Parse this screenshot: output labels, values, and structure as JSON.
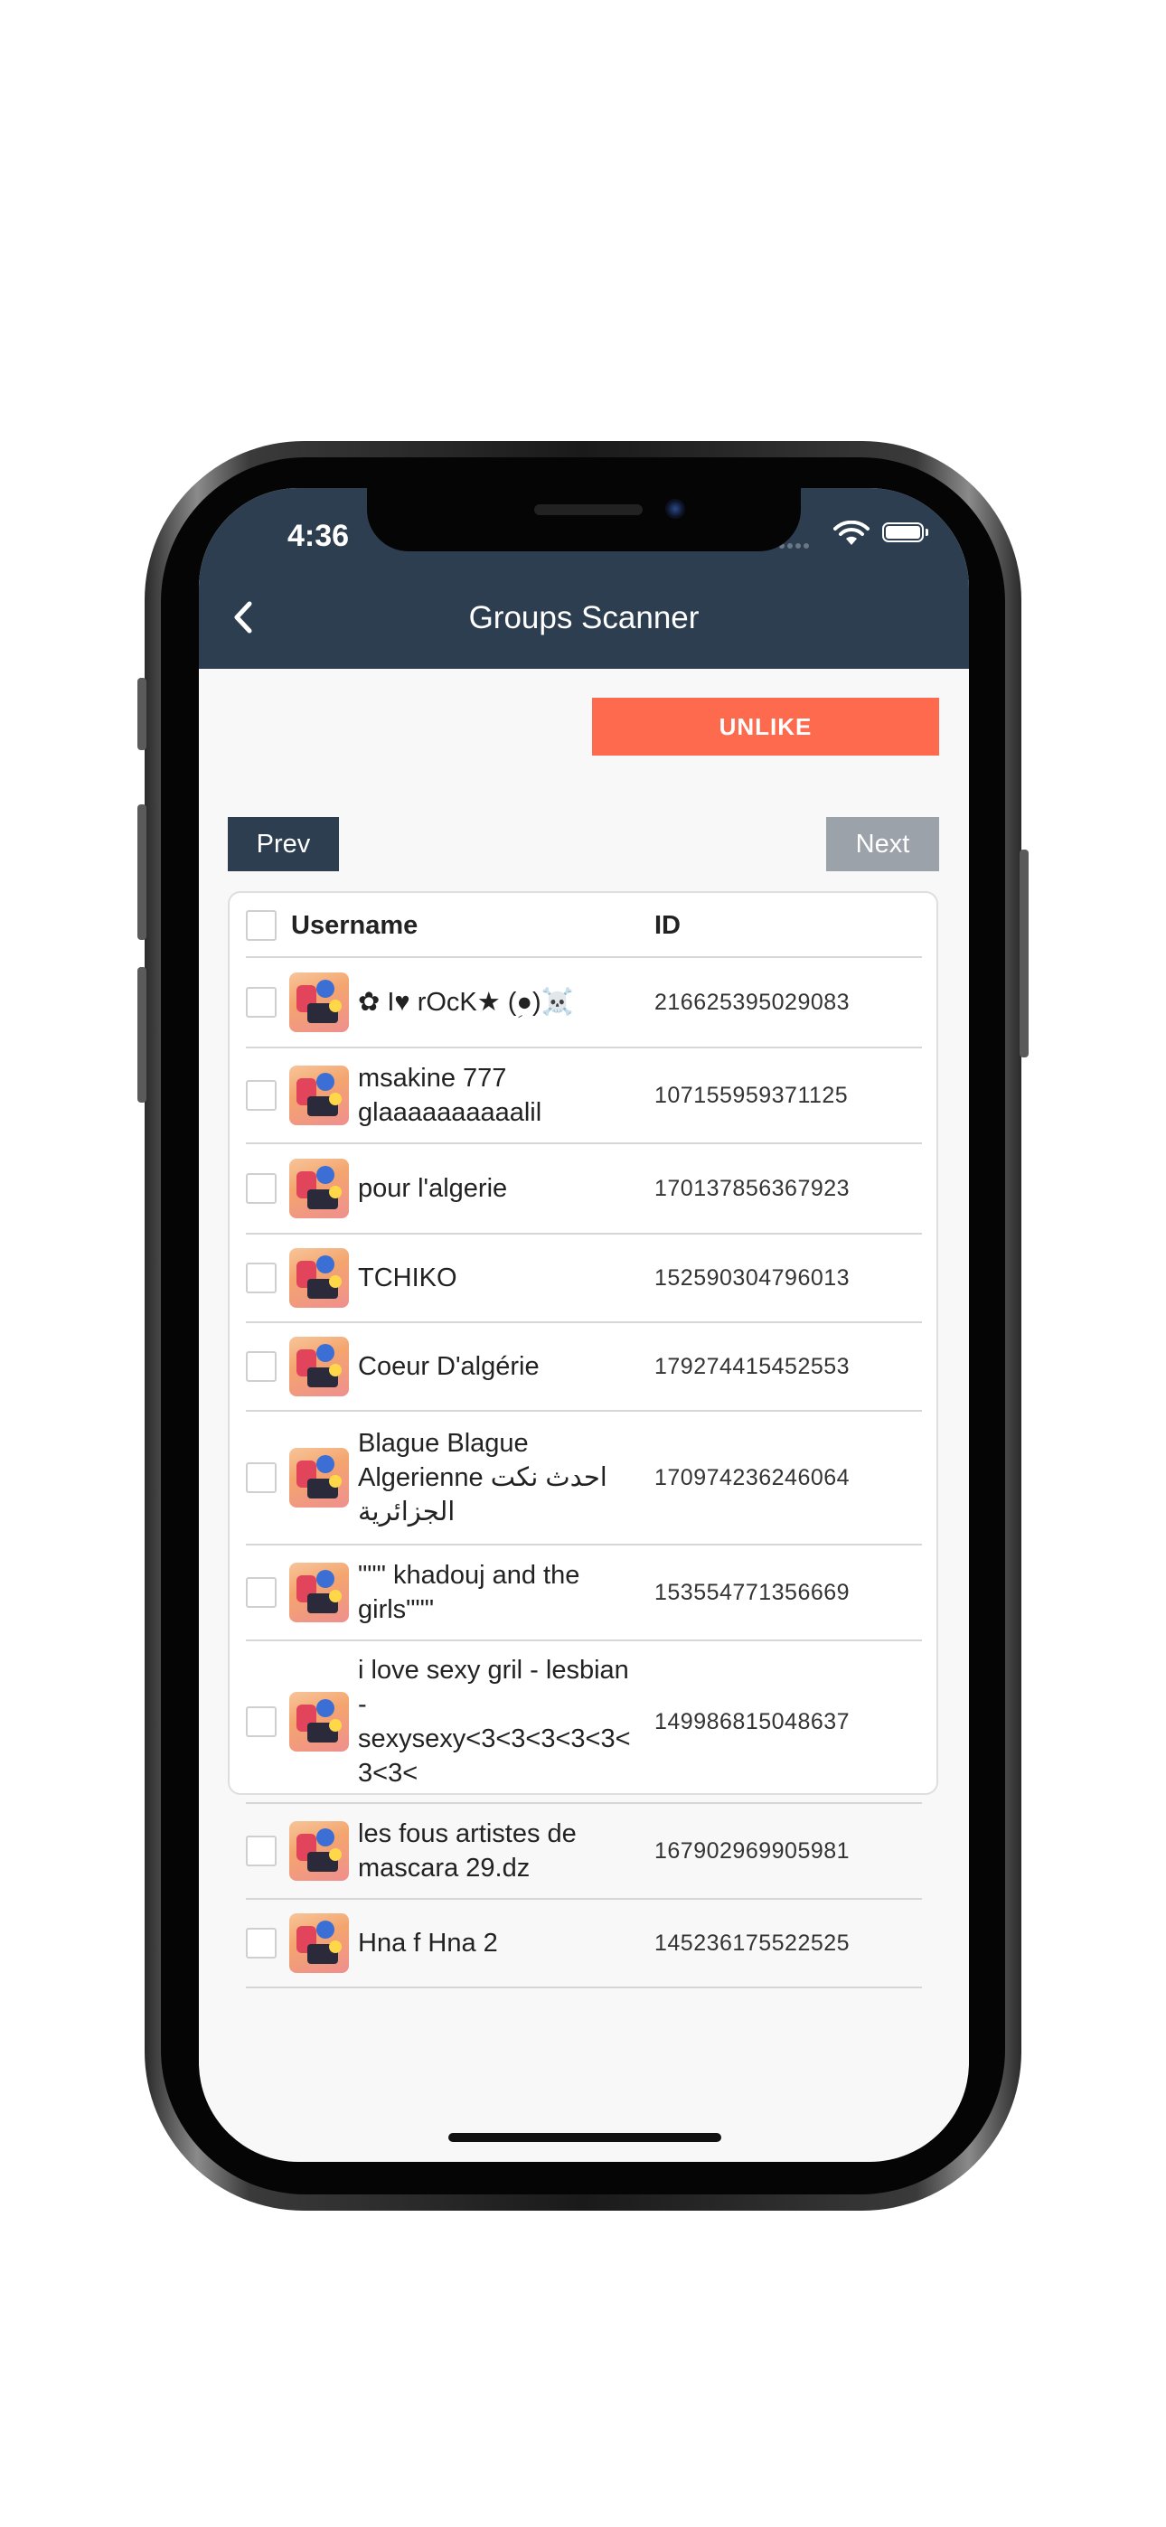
{
  "status_bar": {
    "time": "4:36"
  },
  "header": {
    "title": "Groups Scanner"
  },
  "actions": {
    "unlike_label": "UNLIKE"
  },
  "pagination": {
    "prev_label": "Prev",
    "next_label": "Next"
  },
  "table": {
    "columns": {
      "username": "Username",
      "id": "ID"
    },
    "rows": [
      {
        "username": "✿ I♥ rOcK★ (ؚ●)☠️",
        "id": "216625395029083"
      },
      {
        "username": "msakine 777 glaaaaaaaaaalil",
        "id": "107155959371125"
      },
      {
        "username": "pour l'algerie",
        "id": "170137856367923"
      },
      {
        "username": "TCHIKO",
        "id": "152590304796013"
      },
      {
        "username": "Coeur D'algérie",
        "id": "179274415452553"
      },
      {
        "username": "Blague Blague Algerienne احدث نكت الجزائرية",
        "id": "170974236246064"
      },
      {
        "username": "\"\"\" khadouj and the girls\"\"\"",
        "id": "153554771356669"
      },
      {
        "username": "i love sexy gril - lesbian - sexysexy<3<3<3<3<3<3<3<",
        "id": "149986815048637"
      },
      {
        "username": "les fous artistes de mascara  29.dz",
        "id": "167902969905981"
      },
      {
        "username": "Hna f Hna 2",
        "id": "145236175522525"
      }
    ]
  },
  "colors": {
    "header_bg": "#2d3e50",
    "unlike_bg": "#fe6a4e",
    "next_disabled_bg": "#9ba2a9"
  }
}
